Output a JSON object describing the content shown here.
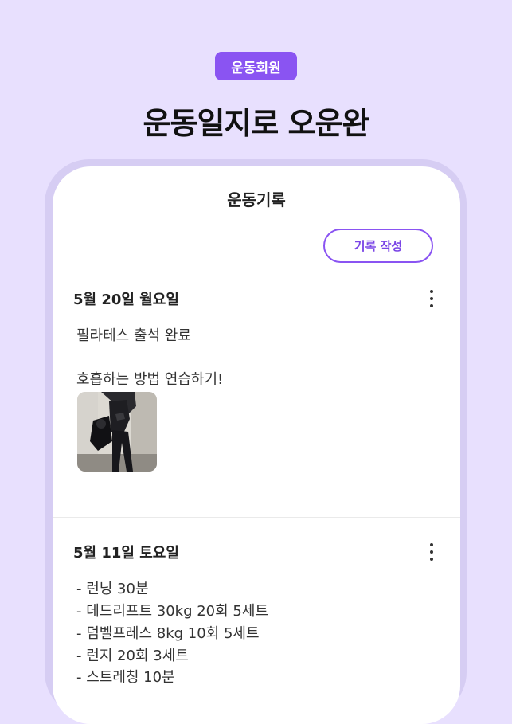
{
  "banner": {
    "badge": "운동회원",
    "headline": "운동일지로 오운완"
  },
  "app": {
    "title": "운동기록",
    "write_button": "기록 작성"
  },
  "entries": [
    {
      "date": "5월 20일 월요일",
      "lines": [
        "필라테스 출석 완료",
        "호흡하는 방법 연습하기!"
      ],
      "has_photo": true
    },
    {
      "date": "5월 11일 토요일",
      "lines": [
        "- 런닝 30분",
        "- 데드리프트 30kg 20회 5세트",
        "- 덤벨프레스 8kg 10회 5세트",
        "- 런지 20회 3세트",
        "- 스트레칭 10분"
      ]
    }
  ],
  "colors": {
    "background": "#E8E0FE",
    "accent": "#8A54F2",
    "phone_frame": "#D6CDF3"
  },
  "icons": {
    "more": "more-vertical-icon"
  }
}
